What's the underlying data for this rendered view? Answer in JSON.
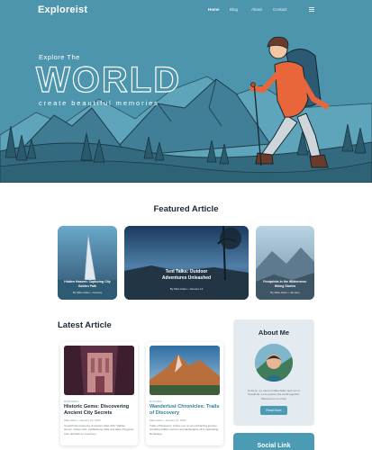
{
  "brand": {
    "logo": "Exploreist"
  },
  "nav": {
    "links": [
      "Home",
      "Blog",
      "About",
      "Contact"
    ],
    "active": 0,
    "menu_icon": "list-icon"
  },
  "hero": {
    "subtitle": "Explore The",
    "title": "WORLD",
    "tagline": "create beautiful memories"
  },
  "colors": {
    "accent": "#4b9bb5",
    "hero_bg": "#4c95ad",
    "text": "#1d2b33"
  },
  "featured": {
    "title": "Featured Article",
    "cards": [
      {
        "title": "Hidden Heaven: Capturing City Golden Path",
        "meta": "By Mike Aiden • January"
      },
      {
        "title": "Tent Talks: Outdoor Adventures Unleashed",
        "meta": "By Mike Aiden • January 12"
      },
      {
        "title": "Footprints in the Wilderness: Hiking Stories",
        "meta": "By Mike Aiden • January"
      }
    ]
  },
  "latest": {
    "title": "Latest Article",
    "posts": [
      {
        "category": "HISTORIC",
        "title": "Historic Gems: Discovering Ancient City Secrets",
        "author": "Mike Aiden",
        "date": "January 22, 2024",
        "excerpt": "Unearth the treasures of ancient cities with \"Hidden Gems\", where lush, cobblestone trails and tales of bygone eras. Embark on a journey..."
      },
      {
        "category": "NATURE",
        "title": "Wanderlust Chronicles: Trails of Discovery",
        "author": "Mike Aiden",
        "date": "January 12, 2024",
        "excerpt": "Trails of Discovery' invites you on an enchanting journey, unveiling hidden corners and landscapes off a captivating landscape."
      }
    ]
  },
  "about": {
    "title": "About Me",
    "text": "Hi there, my name is Mike Aiden and I am a travelholic. Let's explore the world together. Welcome to my blog!",
    "button": "Read More"
  },
  "social": {
    "title": "Social Link"
  }
}
